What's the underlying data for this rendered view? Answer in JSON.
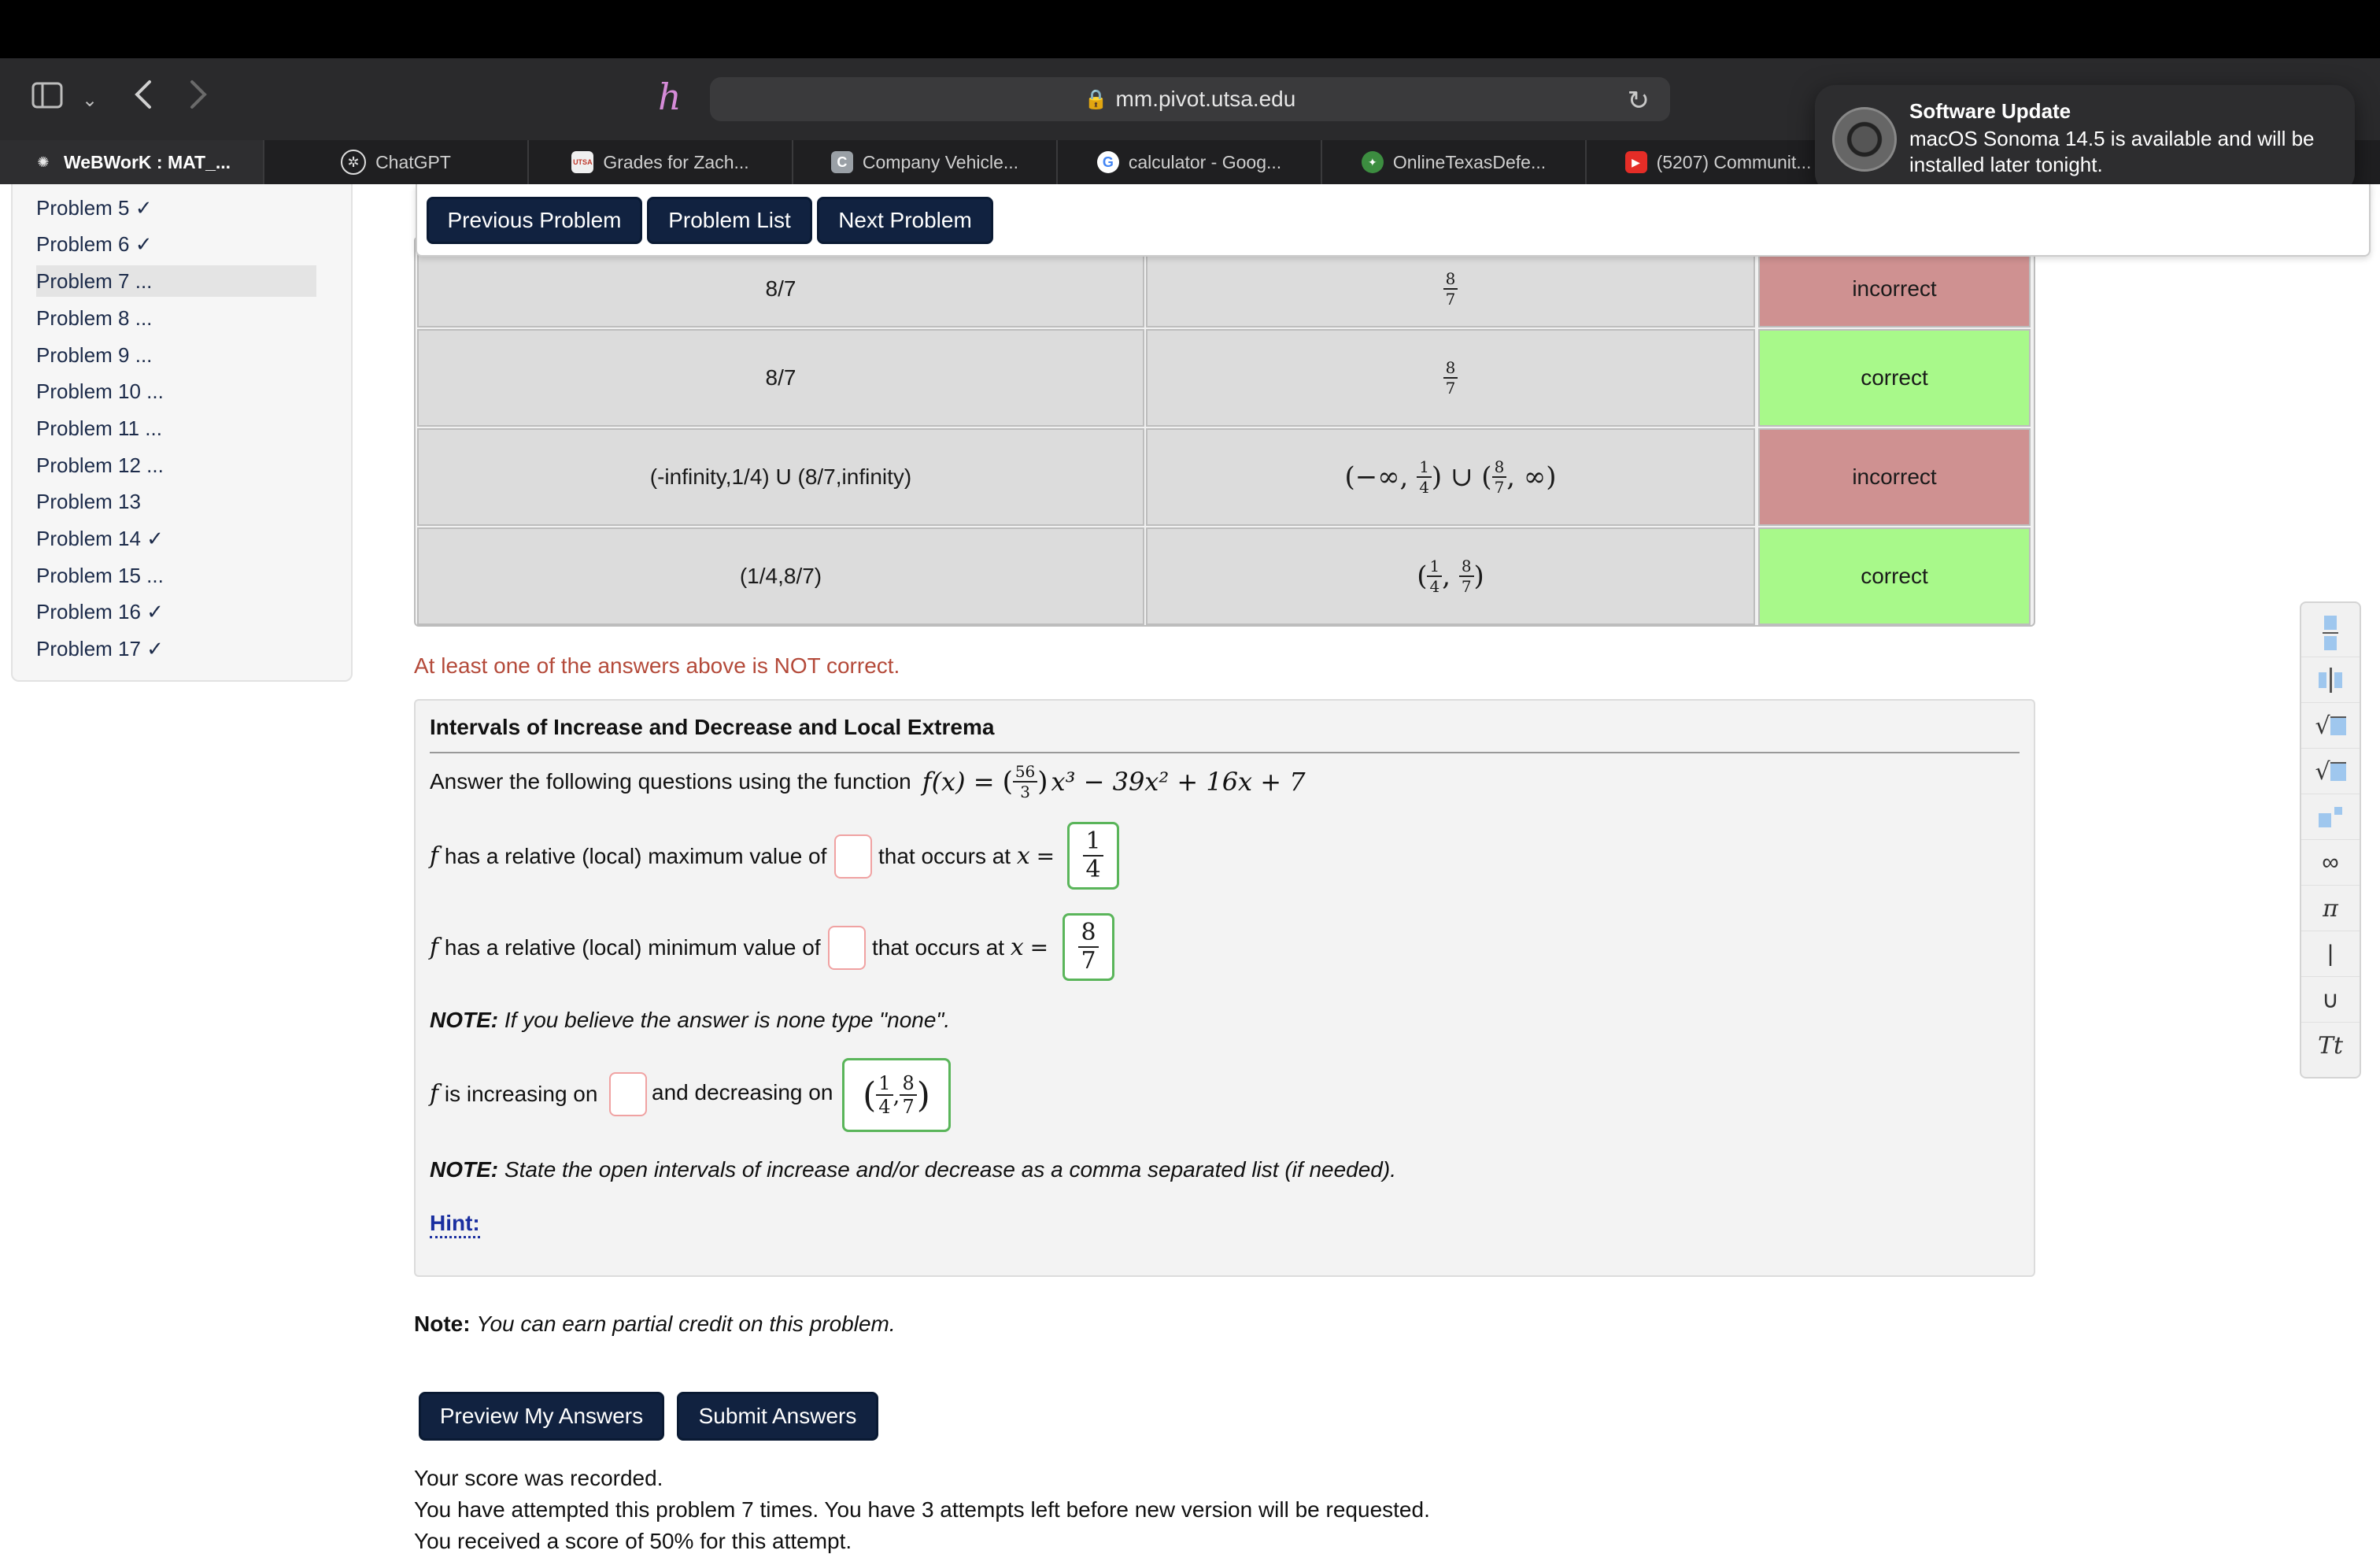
{
  "browser": {
    "url": "mm.pivot.utsa.edu",
    "tabs": [
      {
        "label": "WeBWorK : MAT_...",
        "icon": "webwork-icon"
      },
      {
        "label": "ChatGPT",
        "icon": "chatgpt-icon"
      },
      {
        "label": "Grades for Zach...",
        "icon": "utsa-icon"
      },
      {
        "label": "Company Vehicle...",
        "icon": "c-icon"
      },
      {
        "label": "calculator - Goog...",
        "icon": "google-icon"
      },
      {
        "label": "OnlineTexasDefe...",
        "icon": "texas-icon"
      },
      {
        "label": "(5207) Communit...",
        "icon": "youtube-icon"
      }
    ]
  },
  "notification": {
    "title": "Software Update",
    "body": "macOS Sonoma 14.5 is available and will be installed later tonight."
  },
  "sidebar": {
    "items": [
      "Problem 5 ✓",
      "Problem 6 ✓",
      "Problem 7 ...",
      "Problem 8 ...",
      "Problem 9 ...",
      "Problem 10 ...",
      "Problem 11 ...",
      "Problem 12 ...",
      "Problem 13",
      "Problem 14 ✓",
      "Problem 15 ...",
      "Problem 16 ✓",
      "Problem 17 ✓"
    ],
    "selected": "Problem 7 ..."
  },
  "nav": {
    "previous": "Previous Problem",
    "list": "Problem List",
    "next": "Next Problem"
  },
  "results": {
    "rows": [
      {
        "entered": "8/7",
        "preview": "8/7",
        "status": "incorrect"
      },
      {
        "entered": "8/7",
        "preview": "8/7",
        "status": "correct"
      },
      {
        "entered": "(-infinity,1/4) U (8/7,infinity)",
        "preview": "(−∞, 1/4) ∪ (8/7, ∞)",
        "status": "incorrect"
      },
      {
        "entered": "(1/4,8/7)",
        "preview": "(1/4, 8/7)",
        "status": "correct"
      }
    ],
    "message": "At least one of the answers above is NOT correct."
  },
  "problem": {
    "heading": "Intervals of Increase and Decrease and Local Extrema",
    "intro": "Answer the following questions using the function",
    "fn_lhs": "f(x) =",
    "fn_coef_num": "56",
    "fn_coef_den": "3",
    "fn_rest": "x³ − 39x² + 16x + 7",
    "max_text": "has a relative (local) maximum value of",
    "min_text": "has a relative (local) minimum value of",
    "occurs_text": "that occurs at",
    "max_x_num": "1",
    "max_x_den": "4",
    "min_x_num": "8",
    "min_x_den": "7",
    "note1_label": "NOTE:",
    "note1": "If you believe the answer is none type \"none\".",
    "inc_text": "is increasing on",
    "dec_text": "and decreasing on",
    "dec_answer": "(1/4, 8/7)",
    "note2_label": "NOTE:",
    "note2": "State the open intervals of increase and/or decrease as a comma separated list (if needed).",
    "hint": "Hint:"
  },
  "footer": {
    "note_label": "Note:",
    "note": "You can earn partial credit on this problem.",
    "preview_button": "Preview My Answers",
    "submit_button": "Submit Answers",
    "score_recorded": "Your score was recorded.",
    "attempts": "You have attempted this problem 7 times. You have 3 attempts left before new version will be requested.",
    "score_line": "You received a score of 50% for this attempt."
  },
  "palette": [
    "fraction-icon",
    "mixed-fraction-icon",
    "sqrt-icon",
    "nth-root-icon",
    "exponent-icon",
    "infinity-icon",
    "pi-icon",
    "vertical-bar-icon",
    "union-icon",
    "text-mode-icon"
  ]
}
